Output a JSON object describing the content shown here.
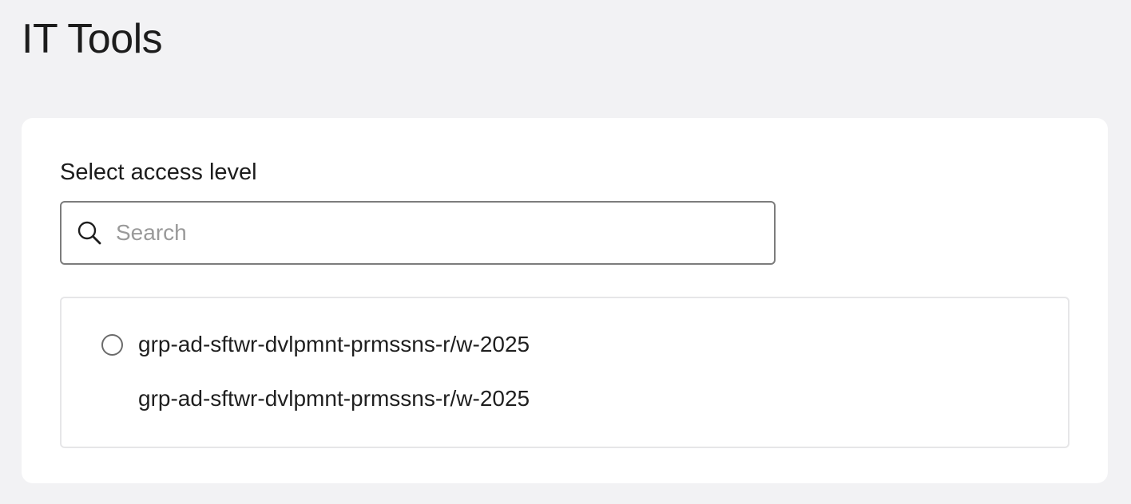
{
  "header": {
    "title": "IT Tools"
  },
  "access_level": {
    "label": "Select access level",
    "search": {
      "value": "",
      "placeholder": "Search",
      "icon": "search-icon"
    },
    "options": [
      {
        "label": "grp-ad-sftwr-dvlpmnt-prmssns-r/w-2025",
        "description": "grp-ad-sftwr-dvlpmnt-prmssns-r/w-2025",
        "selected": false
      }
    ]
  },
  "colors": {
    "background": "#f2f2f4",
    "card": "#ffffff",
    "input_border": "#7c7c7c",
    "panel_border": "#e6e6e8",
    "placeholder": "#9a9a9a"
  }
}
